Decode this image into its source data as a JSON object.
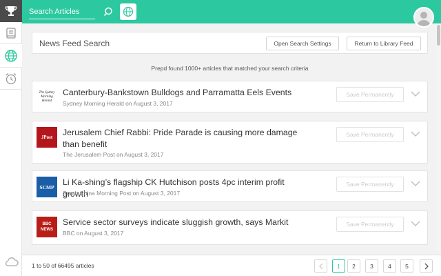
{
  "topbar": {
    "search_placeholder": "Search Articles",
    "accent": "#2cc8a0",
    "icons": [
      "trophy-icon",
      "search-icon",
      "globe-icon",
      "avatar"
    ]
  },
  "sidebar": {
    "icons": [
      "library-icon",
      "globe-icon",
      "alarm-clock-icon",
      "cloud-icon"
    ]
  },
  "header": {
    "title": "News Feed Search",
    "settings_label": "Open Search Settings",
    "library_label": "Return to Library Feed"
  },
  "result_summary": "Prepd found 1000+ articles that matched your search criteria",
  "save_label": "Save Permanently",
  "articles": [
    {
      "title": "Canterbury-Bankstown Bulldogs and Parramatta Eels Events",
      "meta": "Sydney Morning Herald on August 3, 2017",
      "logo_text": "The Sydney Morning Herald"
    },
    {
      "title": "Jerusalem Chief Rabbi: Pride Parade is causing more damage than benefit",
      "meta": "The Jerusalem Post on August 3, 2017",
      "logo_text": "JPost"
    },
    {
      "title": "Li Ka-shing’s flagship CK Hutchison posts 4pc interim profit growth",
      "meta": "South China Morning Post on August 3, 2017",
      "logo_text": "SCMP"
    },
    {
      "title": "Service sector surveys indicate sluggish growth, says Markit",
      "meta": "BBC on August 3, 2017",
      "logo_text": "BBC NEWS"
    }
  ],
  "footer": {
    "count": "1 to 50 of 66495 articles",
    "pages": [
      "1",
      "2",
      "3",
      "4",
      "5"
    ],
    "current_page": "1"
  }
}
